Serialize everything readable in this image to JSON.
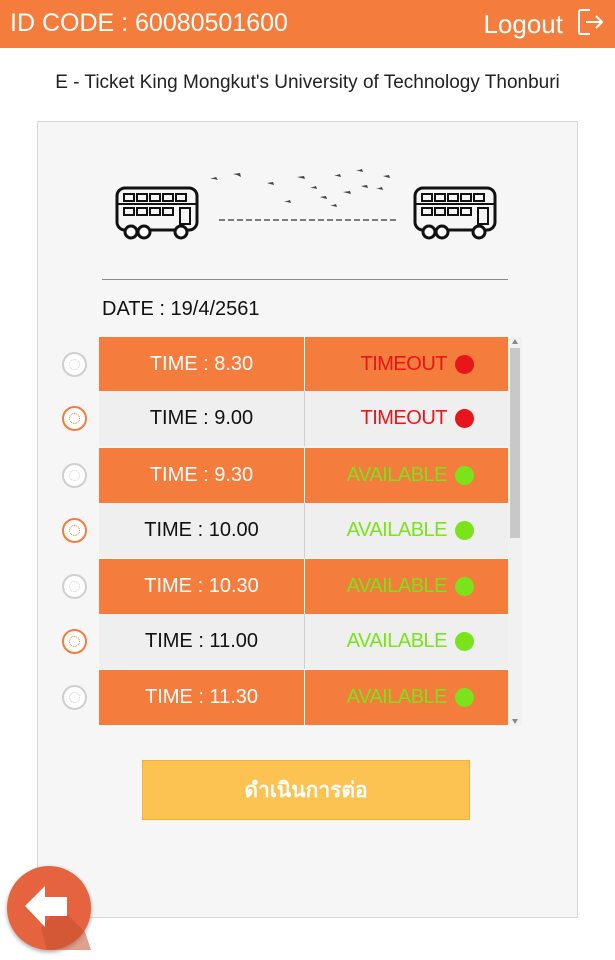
{
  "header": {
    "id_code": "ID CODE : 60080501600",
    "logout_label": "Logout"
  },
  "subtitle": "E - Ticket King Mongkut's University of Technology Thonburi",
  "date_label": "DATE : 19/4/2561",
  "slots": [
    {
      "time": "TIME : 8.30",
      "status": "TIMEOUT",
      "status_color": "#e8151a"
    },
    {
      "time": "TIME : 9.00",
      "status": "TIMEOUT",
      "status_color": "#e8151a"
    },
    {
      "time": "TIME : 9.30",
      "status": "AVAILABLE",
      "status_color": "#7ae31a"
    },
    {
      "time": "TIME : 10.00",
      "status": "AVAILABLE",
      "status_color": "#7ae31a"
    },
    {
      "time": "TIME : 10.30",
      "status": "AVAILABLE",
      "status_color": "#7ae31a"
    },
    {
      "time": "TIME : 11.00",
      "status": "AVAILABLE",
      "status_color": "#7ae31a"
    },
    {
      "time": "TIME : 11.30",
      "status": "AVAILABLE",
      "status_color": "#7ae31a"
    }
  ],
  "continue_label": "ดำเนินการต่อ",
  "colors": {
    "accent": "#f47c3c",
    "button": "#fdc352",
    "back_button": "#e5633e",
    "timeout": "#e8151a",
    "available": "#7ae31a"
  },
  "icons": {
    "logout": "logout-icon",
    "bus": "bus-icon",
    "birds": "birds-illustration",
    "back": "back-arrow-icon"
  }
}
